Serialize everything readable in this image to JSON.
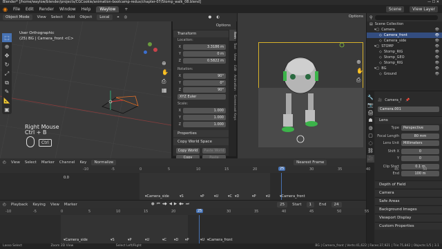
{
  "titlebar": {
    "title": "Blender* [/home/waylow/blender/projects/CGCookie/animation-bootcamp-redux/chapter-07/Stomp_walk_08.blend]",
    "controls": "— ☐ ✕"
  },
  "menubar": {
    "items": [
      "File",
      "Edit",
      "Render",
      "Window",
      "Help"
    ],
    "workspace": "Waylow",
    "scene": "Scene",
    "view_layer": "View Layer"
  },
  "vp_header": {
    "mode": "Object Mode",
    "view": "View",
    "select": "Select",
    "add": "Add",
    "object": "Object",
    "orientation": "Local",
    "options": "Options"
  },
  "viewport": {
    "view_name": "User Orthographic",
    "object_info": "(25) BG | Camera_front <C>",
    "key_hint_1": "Right Mouse",
    "key_hint_2": "Ctrl + B",
    "ctrl_key": "Ctrl"
  },
  "npanel": {
    "transform_title": "Transform",
    "location_label": "Location:",
    "location": [
      {
        "axis": "X",
        "value": "3.3186 m"
      },
      {
        "axis": "Y",
        "value": "0 m"
      },
      {
        "axis": "Z",
        "value": "0.5822 m"
      }
    ],
    "rotation_label": "Rotation:",
    "rotation": [
      {
        "axis": "X",
        "value": "90°"
      },
      {
        "axis": "Y",
        "value": "0°"
      },
      {
        "axis": "Z",
        "value": "90°"
      }
    ],
    "rotation_mode": "XYZ Euler",
    "scale_label": "Scale:",
    "scale": [
      {
        "axis": "X",
        "value": "1.000"
      },
      {
        "axis": "Y",
        "value": "1.000"
      },
      {
        "axis": "Z",
        "value": "1.000"
      }
    ],
    "properties": "Properties",
    "copy_world_space": "Copy World Space",
    "copy_world": "Copy World",
    "paste_world": "Paste World",
    "copy_relative": "Copy Relative",
    "paste_relative": "Paste Relative",
    "tabs": [
      "Item",
      "Tool",
      "View",
      "Edit",
      "Animation",
      "Screencast Keys"
    ]
  },
  "camview": {
    "options": "Options"
  },
  "outliner": {
    "items": [
      {
        "label": "Scene Collection",
        "indent": 0,
        "sel": false
      },
      {
        "label": "Camera",
        "indent": 1,
        "sel": false
      },
      {
        "label": "Camera_front",
        "indent": 2,
        "sel": true
      },
      {
        "label": "Camera_side",
        "indent": 2,
        "sel": false
      },
      {
        "label": "STOMP",
        "indent": 1,
        "sel": false
      },
      {
        "label": "Stomp_RIG",
        "indent": 2,
        "sel": false
      },
      {
        "label": "Stomp_GEO",
        "indent": 2,
        "sel": false
      },
      {
        "label": "Stomp_RIG",
        "indent": 2,
        "sel": false
      },
      {
        "label": "BG",
        "indent": 1,
        "sel": false
      },
      {
        "label": "Ground",
        "indent": 2,
        "sel": false
      }
    ]
  },
  "props": {
    "object_name": "Camera_f",
    "data_name": "Camera.001",
    "lens_section": "Lens",
    "type_label": "Type",
    "type_value": "Perspective",
    "focal_label": "Focal Length",
    "focal_value": "80 mm",
    "units_label": "Lens Unit",
    "units_value": "Millimeters",
    "shiftx_label": "Shift X",
    "shiftx_value": "0",
    "shifty_label": "Y",
    "shifty_value": "0",
    "clip_start_label": "Clip Start",
    "clip_start_value": "0.1 m",
    "clip_end_label": "End",
    "clip_end_value": "100 m",
    "sections": [
      "Depth of Field",
      "Camera",
      "Safe Areas",
      "Background Images",
      "Viewport Display",
      "Custom Properties"
    ]
  },
  "dope1": {
    "menus": [
      "View",
      "Select",
      "Marker",
      "Channel",
      "Key"
    ],
    "mode": "Normalize",
    "snap": "Nearest Frame",
    "ruler": [
      "-10",
      "-5",
      "0",
      "5",
      "10",
      "15",
      "20",
      "25",
      "30",
      "35",
      "40",
      "45",
      "50"
    ],
    "playhead": "25",
    "summary_value": "0.0",
    "markers": [
      "Camera_side",
      "S",
      "P",
      "U",
      "C",
      "D",
      "P",
      "U",
      "Camera_front"
    ]
  },
  "timeline": {
    "menus": [
      "Playback",
      "Keying",
      "View",
      "Marker"
    ],
    "current_frame": "25",
    "start_label": "Start",
    "start_value": "1",
    "end_label": "End",
    "end_value": "24",
    "ruler": [
      "-10",
      "-5",
      "0",
      "5",
      "10",
      "15",
      "20",
      "25",
      "30",
      "35",
      "40",
      "45",
      "50",
      "55"
    ],
    "playhead": "25",
    "markers": [
      "Camera_side",
      "S",
      "P",
      "U",
      "C",
      "D",
      "P",
      "U",
      "Camera_front"
    ]
  },
  "statusbar": {
    "left1": "Lasso Select",
    "left2": "Zoom 2D View",
    "left3": "Select Left/Right",
    "right": "BG | Camera_front | Verts:41,622 | Faces:37,921 | Tris:75,842 | Objects:1/5 | 3.1"
  }
}
